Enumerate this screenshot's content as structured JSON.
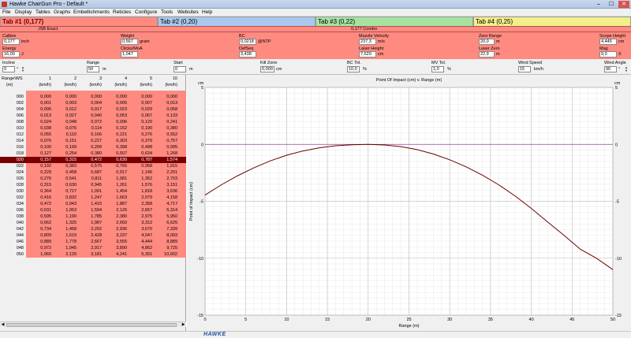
{
  "window": {
    "title": "Hawke ChairGun Pro - Default *",
    "minimize": "–",
    "maximize": "☐",
    "close": "✕"
  },
  "menu": [
    "File",
    "Display",
    "Tables",
    "Graphs",
    "Embellishments",
    "Reticles",
    "Configure",
    "Tools",
    "Websites",
    "Help"
  ],
  "tabs": [
    {
      "label": "Tab #1 (0,177)",
      "color": "#ff8a80"
    },
    {
      "label": "Tab #2 (0,20)",
      "color": "#a9c8ef"
    },
    {
      "label": "Tab #3 (0,22)",
      "color": "#a6e3a0"
    },
    {
      "label": "Tab #4 (0,25)",
      "color": "#f3ef8a"
    }
  ],
  "subtitle": {
    "left": "JSB Exact",
    "center": "0,177 Combo"
  },
  "params": {
    "calibre": {
      "label": "Calibre",
      "value": "0,177",
      "unit": "inch"
    },
    "weight": {
      "label": "Weight",
      "value": "0,567",
      "unit": "gram"
    },
    "bc": {
      "label": "BC",
      "value": "0,0218",
      "unit": "@NTP"
    },
    "muzzle_velocity": {
      "label": "Muzzle Velocity",
      "value": "237,3",
      "unit": "m/s"
    },
    "zero_range": {
      "label": "Zero Range",
      "value": "20,0",
      "unit": "m"
    },
    "scope_height": {
      "label": "Scope Height",
      "value": "4,445",
      "unit": "cm"
    },
    "energy": {
      "label": "Energy",
      "value": "16,00",
      "unit": "J"
    },
    "clicks_moa": {
      "label": "Clicks/MoA",
      "value": "1,047",
      "unit": ""
    },
    "def_seq": {
      "label": "DefSeq",
      "value": "3,438",
      "unit": ""
    },
    "laser_height": {
      "label": "Laser Height",
      "value": "7,620",
      "unit": "cm"
    },
    "laser_zero": {
      "label": "Laser Zero",
      "value": "22,9",
      "unit": "m"
    },
    "mag": {
      "label": "Mag",
      "value": "9,0",
      "unit": "X"
    }
  },
  "inputs": {
    "incline": {
      "label": "Incline",
      "value": "0",
      "unit": "°"
    },
    "range": {
      "label": "Range",
      "value": "50",
      "unit": "m"
    },
    "start": {
      "label": "Start",
      "value": "0",
      "unit": "m"
    },
    "kill_zone": {
      "label": "Kill Zone",
      "value": "0,000",
      "unit": "cm"
    },
    "bc_tol": {
      "label": "BC Tol.",
      "value": "10,0",
      "unit": "%"
    },
    "mv_tol": {
      "label": "MV Tol.",
      "value": "1,0",
      "unit": "%"
    },
    "wind_speed": {
      "label": "Wind Speed",
      "value": "15",
      "unit": "km/h"
    },
    "wind_angle": {
      "label": "Wind Angle",
      "value": "90",
      "unit": "°"
    }
  },
  "table": {
    "header_top": [
      "Range\\WS",
      "1",
      "2",
      "3",
      "4",
      "5",
      "10"
    ],
    "header_bottom": [
      "(m)",
      "(km/h)",
      "(km/h)",
      "(km/h)",
      "(km/h)",
      "(km/h)",
      "(km/h)"
    ],
    "selected_range": "020",
    "rows": [
      [
        "000",
        "0,000",
        "0,000",
        "0,000",
        "0,000",
        "0,000",
        "0,000"
      ],
      [
        "002",
        "0,001",
        "0,003",
        "0,004",
        "0,005",
        "0,007",
        "0,013"
      ],
      [
        "004",
        "0,006",
        "0,012",
        "0,017",
        "0,023",
        "0,029",
        "0,058"
      ],
      [
        "006",
        "0,013",
        "0,027",
        "0,040",
        "0,053",
        "0,067",
        "0,133"
      ],
      [
        "008",
        "0,024",
        "0,048",
        "0,072",
        "0,096",
        "0,120",
        "0,241"
      ],
      [
        "010",
        "0,038",
        "0,076",
        "0,114",
        "0,152",
        "0,190",
        "0,380"
      ],
      [
        "012",
        "0,055",
        "0,110",
        "0,166",
        "0,221",
        "0,276",
        "0,552"
      ],
      [
        "014",
        "0,076",
        "0,151",
        "0,227",
        "0,303",
        "0,379",
        "0,757"
      ],
      [
        "016",
        "0,100",
        "0,199",
        "0,299",
        "0,398",
        "0,498",
        "0,995"
      ],
      [
        "018",
        "0,127",
        "0,254",
        "0,380",
        "0,507",
        "0,634",
        "1,268"
      ],
      [
        "020",
        "0,157",
        "0,315",
        "0,472",
        "0,630",
        "0,787",
        "1,574"
      ],
      [
        "022",
        "0,192",
        "0,383",
        "0,575",
        "0,766",
        "0,958",
        "1,915"
      ],
      [
        "024",
        "0,229",
        "0,458",
        "0,687",
        "0,917",
        "1,146",
        "2,291"
      ],
      [
        "026",
        "0,270",
        "0,541",
        "0,811",
        "1,081",
        "1,352",
        "2,703"
      ],
      [
        "028",
        "0,315",
        "0,630",
        "0,945",
        "1,261",
        "1,576",
        "3,151"
      ],
      [
        "030",
        "0,364",
        "0,727",
        "1,091",
        "1,454",
        "1,818",
        "3,636"
      ],
      [
        "032",
        "0,416",
        "0,832",
        "1,247",
        "1,663",
        "2,079",
        "4,158"
      ],
      [
        "034",
        "0,472",
        "0,943",
        "1,415",
        "1,887",
        "2,358",
        "4,717"
      ],
      [
        "036",
        "0,531",
        "1,063",
        "1,594",
        "2,126",
        "2,657",
        "5,314"
      ],
      [
        "038",
        "0,595",
        "1,190",
        "1,785",
        "2,380",
        "2,975",
        "5,950"
      ],
      [
        "040",
        "0,662",
        "1,325",
        "1,987",
        "2,650",
        "3,312",
        "6,625"
      ],
      [
        "042",
        "0,734",
        "1,468",
        "2,202",
        "2,936",
        "3,670",
        "7,339"
      ],
      [
        "044",
        "0,809",
        "1,619",
        "2,428",
        "3,237",
        "4,047",
        "8,093"
      ],
      [
        "046",
        "0,889",
        "1,778",
        "2,667",
        "3,555",
        "4,444",
        "8,889"
      ],
      [
        "048",
        "0,972",
        "1,945",
        "2,917",
        "3,890",
        "4,862",
        "9,725"
      ],
      [
        "050",
        "1,060",
        "2,120",
        "3,181",
        "4,241",
        "5,301",
        "10,602"
      ]
    ]
  },
  "chart_data": {
    "type": "line",
    "title": "Point Of Impact (cm) v. Range (m)",
    "xlabel": "Range (m)",
    "ylabel": "Point of Impact (cm)",
    "y_unit_left": "cm",
    "y_unit_right": "cm",
    "xlim": [
      0,
      50
    ],
    "ylim": [
      -15,
      5
    ],
    "x_ticks": [
      0,
      5,
      10,
      15,
      20,
      25,
      30,
      35,
      40,
      45,
      50
    ],
    "y_ticks": [
      5,
      0,
      -5,
      -10,
      -15
    ],
    "grid": true,
    "series": [
      {
        "x": [
          0,
          2,
          4,
          6,
          8,
          10,
          12,
          14,
          16,
          18,
          20,
          22,
          24,
          26,
          28,
          30,
          32,
          34,
          36,
          38,
          40,
          42,
          44,
          46,
          48,
          50
        ],
        "y": [
          -4.45,
          -3.55,
          -2.75,
          -2.05,
          -1.45,
          -0.95,
          -0.58,
          -0.3,
          -0.12,
          -0.03,
          0.0,
          -0.05,
          -0.2,
          -0.46,
          -0.85,
          -1.35,
          -1.97,
          -2.7,
          -3.55,
          -4.52,
          -5.62,
          -6.82,
          -7.98,
          -9.2,
          -10.0,
          -11.0
        ],
        "color": "#6b0000"
      }
    ],
    "zero_line_color": "#9b3f8f"
  },
  "logo_text": "HAWKE"
}
